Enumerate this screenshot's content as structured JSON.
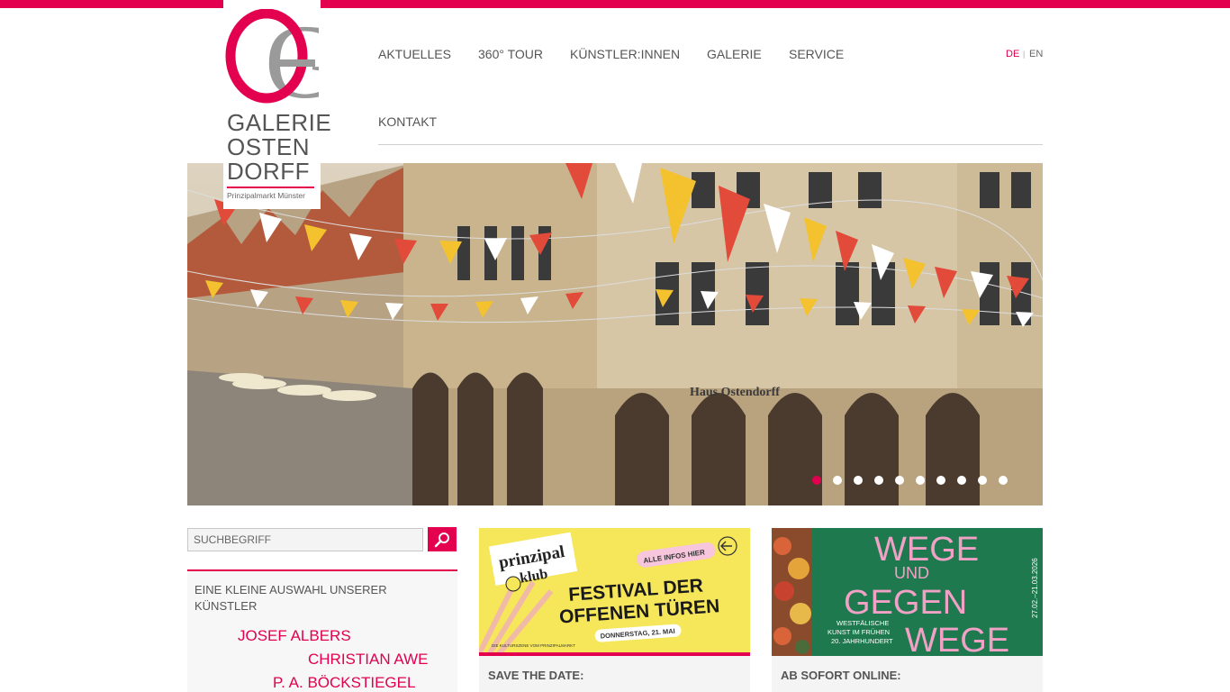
{
  "logo": {
    "line1": "GALERIE",
    "line2": "OSTEN",
    "line3": "DORFF",
    "tagline": "Prinzipalmarkt Münster"
  },
  "nav": {
    "items": [
      {
        "label": "AKTUELLES"
      },
      {
        "label": "360° TOUR"
      },
      {
        "label": "KÜNSTLER:INNEN"
      },
      {
        "label": "GALERIE"
      },
      {
        "label": "SERVICE"
      },
      {
        "label": "KONTAKT"
      }
    ]
  },
  "lang": {
    "de": "DE",
    "sep": "|",
    "en": "EN",
    "active": "DE"
  },
  "slider": {
    "total_slides": 10,
    "active_index": 0,
    "shop_sign": "Haus Ostendorff"
  },
  "search": {
    "placeholder": "SUCHBEGRIFF"
  },
  "artists": {
    "heading": "EINE KLEINE AUSWAHL UNSERER KÜNSTLER",
    "names": [
      "JOSEF ALBERS",
      "CHRISTIAN AWE",
      "P. A. BÖCKSTIEGEL"
    ]
  },
  "cards": [
    {
      "label": "SAVE THE DATE:",
      "image": {
        "brand": "prinzipal",
        "brand2": "klub",
        "badge": "ALLE INFOS HIER",
        "title_line1": "FESTIVAL DER",
        "title_line2": "OFFENEN TÜREN",
        "date": "DONNERSTAG, 21. MAI",
        "footer": "DIE KULTURSZENE VOM PRINZIPALMARKT"
      }
    },
    {
      "label": "AB SOFORT ONLINE:",
      "image": {
        "title1": "WEGE",
        "title2": "UND",
        "title3": "GEGEN",
        "title4": "WEGE",
        "subtitle1": "WESTFÄLISCHE",
        "subtitle2": "KUNST IM FRÜHEN",
        "subtitle3": "20. JAHRHUNDERT",
        "dates": "27.02.–21.03.2026"
      }
    }
  ],
  "colors": {
    "accent": "#e2004f",
    "festival_yellow": "#f5e65a",
    "exhibition_green": "#1e7a4e",
    "exhibition_pink": "#f2a1c6"
  }
}
